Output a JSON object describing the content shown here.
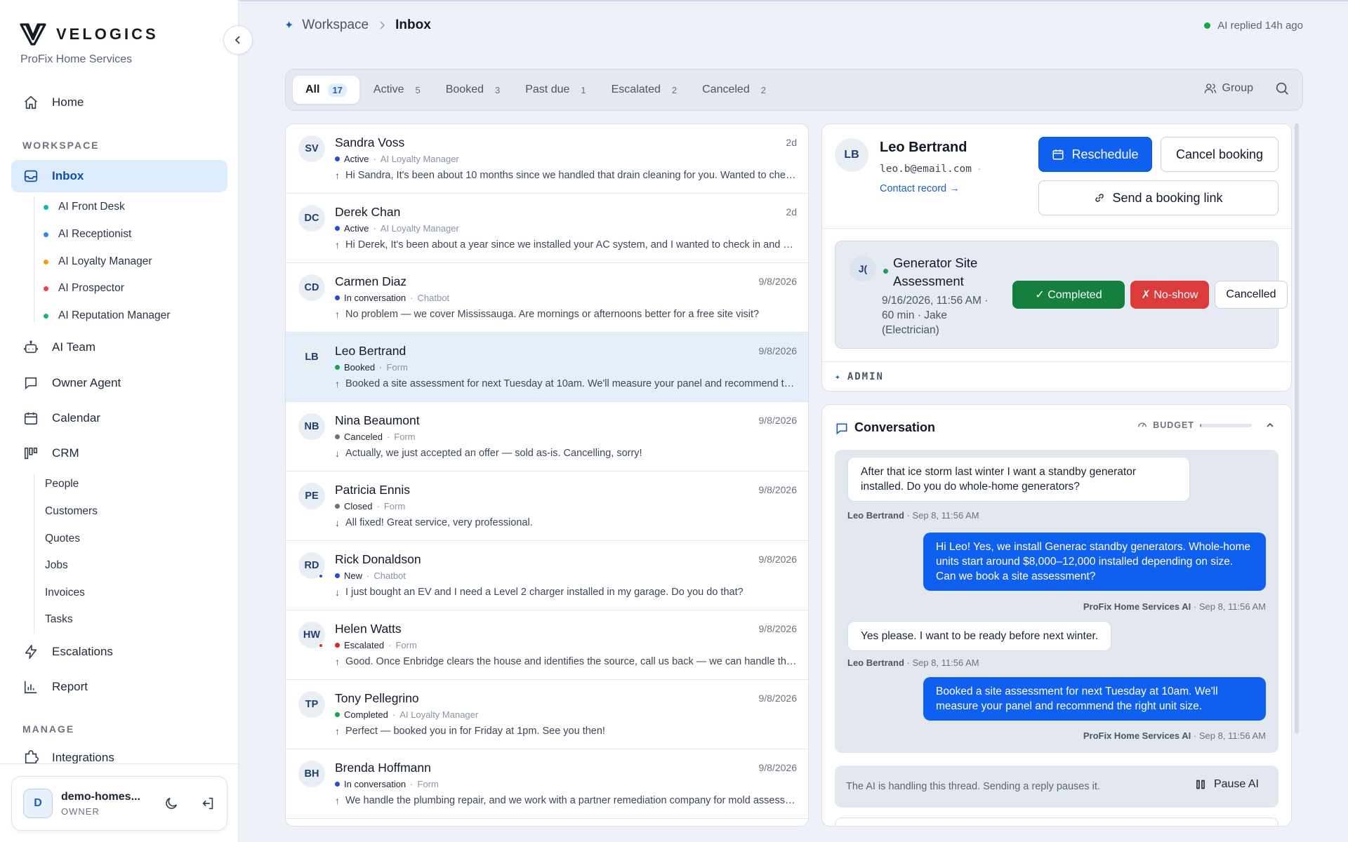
{
  "brand": {
    "name": "VELOGICS",
    "company": "ProFix Home Services"
  },
  "nav": {
    "home": "Home",
    "workspace_label": "WORKSPACE",
    "inbox": "Inbox",
    "ai_agents": [
      {
        "label": "AI Front Desk",
        "color": "#14b8a6"
      },
      {
        "label": "AI Receptionist",
        "color": "#3b82f6"
      },
      {
        "label": "AI Loyalty Manager",
        "color": "#f59e0b"
      },
      {
        "label": "AI Prospector",
        "color": "#ef4444"
      },
      {
        "label": "AI Reputation Manager",
        "color": "#10b981"
      }
    ],
    "ai_team": "AI Team",
    "owner_agent": "Owner Agent",
    "calendar": "Calendar",
    "crm": "CRM",
    "crm_items": [
      "People",
      "Customers",
      "Quotes",
      "Jobs",
      "Invoices",
      "Tasks"
    ],
    "escalations": "Escalations",
    "report": "Report",
    "manage_label": "MANAGE",
    "integrations": "Integrations"
  },
  "user": {
    "initial": "D",
    "name": "demo-homes...",
    "role": "OWNER"
  },
  "breadcrumb": {
    "parent": "Workspace",
    "current": "Inbox"
  },
  "status": {
    "text": "AI replied 14h ago",
    "color": "#16a34a"
  },
  "filters": [
    {
      "label": "All",
      "count": "17"
    },
    {
      "label": "Active",
      "count": "5"
    },
    {
      "label": "Booked",
      "count": "3"
    },
    {
      "label": "Past due",
      "count": "1"
    },
    {
      "label": "Escalated",
      "count": "2"
    },
    {
      "label": "Canceled",
      "count": "2"
    }
  ],
  "group_label": "Group",
  "conversations": [
    {
      "initials": "SV",
      "name": "Sandra Voss",
      "date": "2d",
      "status": "Active",
      "status_color": "#1d4ed8",
      "source": "AI Loyalty Manager",
      "direction": "↑",
      "message": "Hi Sandra, It's been about 10 months since we handled that drain cleaning for you. Wanted to check in and see how everything is holding up."
    },
    {
      "initials": "DC",
      "name": "Derek Chan",
      "date": "2d",
      "status": "Active",
      "status_color": "#1d4ed8",
      "source": "AI Loyalty Manager",
      "direction": "↑",
      "message": "Hi Derek, It's been about a year since we installed your AC system, and I wanted to check in and see how it's running."
    },
    {
      "initials": "CD",
      "name": "Carmen Diaz",
      "date": "9/8/2026",
      "status": "In conversation",
      "status_color": "#1d4ed8",
      "source": "Chatbot",
      "direction": "↑",
      "message": "No problem — we cover Mississauga. Are mornings or afternoons better for a free site visit?"
    },
    {
      "initials": "LB",
      "name": "Leo Bertrand",
      "date": "9/8/2026",
      "status": "Booked",
      "status_color": "#16a34a",
      "source": "Form",
      "direction": "↑",
      "message": "Booked a site assessment for next Tuesday at 10am. We'll measure your panel and recommend the right unit size."
    },
    {
      "initials": "NB",
      "name": "Nina Beaumont",
      "date": "9/8/2026",
      "status": "Canceled",
      "status_color": "#6b7280",
      "source": "Form",
      "direction": "↓",
      "message": "Actually, we just accepted an offer — sold as-is. Cancelling, sorry!"
    },
    {
      "initials": "PE",
      "name": "Patricia Ennis",
      "date": "9/8/2026",
      "status": "Closed",
      "status_color": "#6b7280",
      "source": "Form",
      "direction": "↓",
      "message": "All fixed! Great service, very professional."
    },
    {
      "initials": "RD",
      "name": "Rick Donaldson",
      "date": "9/8/2026",
      "status": "New",
      "status_color": "#1d4ed8",
      "source": "Chatbot",
      "direction": "↓",
      "message": "I just bought an EV and I need a Level 2 charger installed in my garage. Do you do that?",
      "avatar_dot": "#1d4ed8"
    },
    {
      "initials": "HW",
      "name": "Helen Watts",
      "date": "9/8/2026",
      "status": "Escalated",
      "status_color": "#dc2626",
      "source": "Form",
      "direction": "↑",
      "message": "Good. Once Enbridge clears the house and identifies the source, call us back — we can handle the repair.",
      "avatar_dot": "#dc2626"
    },
    {
      "initials": "TP",
      "name": "Tony Pellegrino",
      "date": "9/8/2026",
      "status": "Completed",
      "status_color": "#16a34a",
      "source": "AI Loyalty Manager",
      "direction": "↑",
      "message": "Perfect — booked you in for Friday at 1pm. See you then!"
    },
    {
      "initials": "BH",
      "name": "Brenda Hoffmann",
      "date": "9/8/2026",
      "status": "In conversation",
      "status_color": "#1d4ed8",
      "source": "Form",
      "direction": "↑",
      "message": "We handle the plumbing repair, and we work with a partner remediation company for mold assessment."
    }
  ],
  "contact": {
    "initials": "LB",
    "name": "Leo Bertrand",
    "email": "leo.b@email.com",
    "email_suffix": "·",
    "record_link": "Contact record →",
    "reschedule": "Reschedule",
    "cancel_booking": "Cancel booking",
    "send_link": "Send a booking link"
  },
  "appointment": {
    "initials": "J(",
    "title": "Generator Site Assessment",
    "details": "9/16/2026, 11:56 AM · 60 min · Jake (Electrician)",
    "completed": "✓ Completed",
    "no_show": "✗ No-show",
    "cancelled": "Cancelled"
  },
  "admin_label": "ADMIN",
  "conversation": {
    "title": "Conversation",
    "budget_label": "BUDGET",
    "budget_fraction": 0.03,
    "messages": [
      {
        "side": "in",
        "text": "After that ice storm last winter I want a standby generator installed. Do you do whole-home generators?",
        "author": "Leo Bertrand",
        "time": " · Sep 8, 11:56 AM"
      },
      {
        "side": "out",
        "text": "Hi Leo! Yes, we install Generac standby generators. Whole-home units start around $8,000–12,000 installed depending on size. Can we book a site assessment?",
        "author": "ProFix Home Services AI",
        "time": " · Sep 8, 11:56 AM"
      },
      {
        "side": "in",
        "text": "Yes please. I want to be ready before next winter.",
        "author": "Leo Bertrand",
        "time": " · Sep 8, 11:56 AM"
      },
      {
        "side": "out",
        "text": "Booked a site assessment for next Tuesday at 10am. We'll measure your panel and recommend the right unit size.",
        "author": "ProFix Home Services AI",
        "time": " · Sep 8, 11:56 AM"
      }
    ],
    "ai_notice": "The AI is handling this thread. Sending a reply pauses it.",
    "pause_label": "Pause AI"
  }
}
